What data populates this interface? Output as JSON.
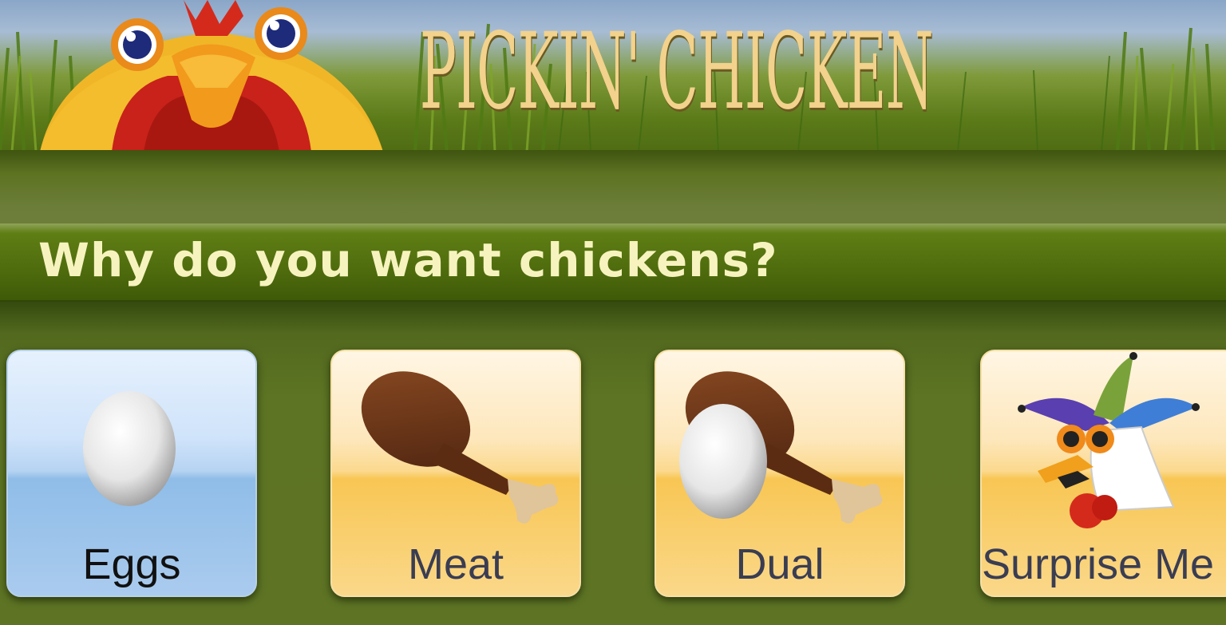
{
  "header": {
    "title": "PICKIN' CHICKEN",
    "mascot_icon": "chicken-mascot-icon"
  },
  "question": "Why do you want chickens?",
  "options": [
    {
      "label": "Eggs",
      "icon": "egg-icon",
      "selected": true
    },
    {
      "label": "Meat",
      "icon": "drumstick-icon",
      "selected": false
    },
    {
      "label": "Dual",
      "icon": "egg-and-drumstick-icon",
      "selected": false
    },
    {
      "label": "Surprise Me",
      "icon": "jester-chicken-icon",
      "selected": false
    }
  ],
  "colors": {
    "selected_tile": "#b6d3f2",
    "option_tile": "#fbd98e",
    "question_text": "#f7f3bf",
    "title_text": "#f2d28c",
    "background": "#5f7420"
  }
}
